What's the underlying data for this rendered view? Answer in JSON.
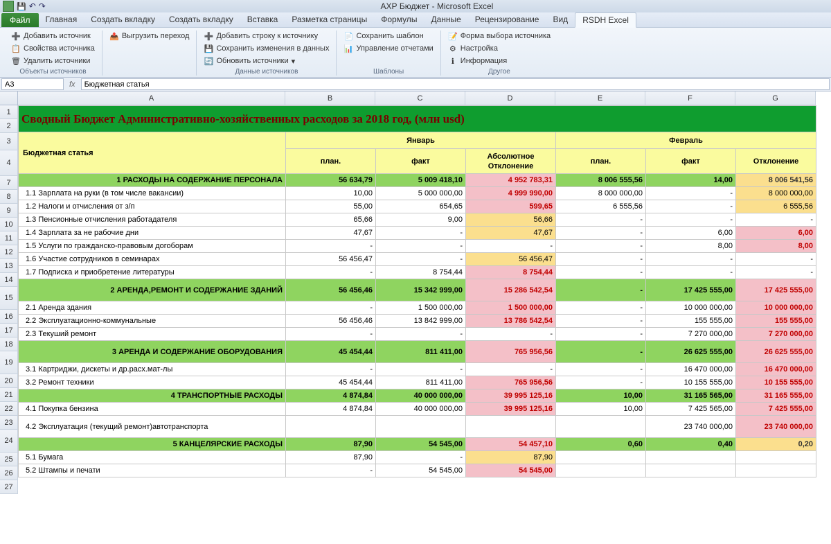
{
  "app": {
    "title": "АХР Бюджет  -  Microsoft Excel"
  },
  "tabs": {
    "file": "Файл",
    "items": [
      "Главная",
      "Создать вкладку",
      "Создать вкладку",
      "Вставка",
      "Разметка страницы",
      "Формулы",
      "Данные",
      "Рецензирование",
      "Вид",
      "RSDH Excel"
    ]
  },
  "ribbon": {
    "g1": {
      "i1": "Добавить источник",
      "i2": "Свойства источника",
      "i3": "Удалить источники",
      "label": "Объекты источников"
    },
    "g2": {
      "i1": "Выгрузить переход",
      "label": ""
    },
    "g3": {
      "i1": "Добавить строку к источнику",
      "i2": "Сохранить изменения в данных",
      "i3": "Обновить источники",
      "label": "Данные источников"
    },
    "g4": {
      "i1": "Сохранить шаблон",
      "i2": "Управление отчетами",
      "label": "Шаблоны"
    },
    "g5": {
      "i1": "Форма выбора источника",
      "i2": "Настройка",
      "i3": "Информация",
      "label": "Другое"
    }
  },
  "namebox": {
    "ref": "A3",
    "fx": "fx",
    "formula": "Бюджетная статья"
  },
  "cols": [
    "A",
    "B",
    "C",
    "D",
    "E",
    "F",
    "G"
  ],
  "rownums": [
    "1",
    "2",
    "3",
    "4",
    "7",
    "8",
    "9",
    "10",
    "11",
    "12",
    "13",
    "14",
    "15",
    "16",
    "17",
    "18",
    "19",
    "20",
    "21",
    "22",
    "23",
    "24",
    "25",
    "26",
    "27"
  ],
  "sheet": {
    "title": "Сводный Бюджет Административно-хозяйственных расходов за 2018 год, (млн usd)",
    "colA_header": "Бюджетная статья",
    "month1": "Январь",
    "month2": "Февраль",
    "sub": {
      "plan": "план.",
      "fact": "факт",
      "devAbs": "Абсолютное Отклонение",
      "dev": "Отклонение"
    },
    "rows": [
      {
        "n": "7",
        "type": "cat",
        "a": "1 РАСХОДЫ НА СОДЕРЖАНИЕ ПЕРСОНАЛА",
        "b": "56 634,79",
        "c": "5 009 418,10",
        "d": "4 952 783,31",
        "e": "8 006 555,56",
        "f": "14,00",
        "g": "8 006 541,56",
        "gcls": "orange"
      },
      {
        "n": "8",
        "a": "1.1 Зарплата на руки (в том числе вакансии)",
        "b": "10,00",
        "c": "5 000 000,00",
        "d": "4 999 990,00",
        "dcls": "pink",
        "e": "8 000 000,00",
        "f": "-",
        "g": "8 000 000,00",
        "gcls": "orange"
      },
      {
        "n": "9",
        "a": "1.2 Налоги и отчисления от з/п",
        "b": "55,00",
        "c": "654,65",
        "d": "599,65",
        "dcls": "pink",
        "e": "6 555,56",
        "f": "-",
        "g": "6 555,56",
        "gcls": "orange"
      },
      {
        "n": "10",
        "a": "1.3 Пенсионные отчисления работадателя",
        "b": "65,66",
        "c": "9,00",
        "d": "56,66",
        "dcls": "orange",
        "e": "-",
        "f": "-",
        "g": "-"
      },
      {
        "n": "11",
        "a": "1.4 Зарплата за не рабочие дни",
        "b": "47,67",
        "c": "-",
        "d": "47,67",
        "dcls": "orange",
        "e": "-",
        "f": "6,00",
        "g": "6,00",
        "gcls": "pink"
      },
      {
        "n": "12",
        "a": "1.5 Услуги по гражданско-правовым догоборам",
        "b": "-",
        "c": "-",
        "d": "-",
        "e": "-",
        "f": "8,00",
        "g": "8,00",
        "gcls": "pink"
      },
      {
        "n": "13",
        "a": "1.6 Участие сотрудников в семинарах",
        "b": "56 456,47",
        "c": "-",
        "d": "56 456,47",
        "dcls": "orange",
        "e": "-",
        "f": "-",
        "g": "-"
      },
      {
        "n": "14",
        "a": "1.7 Подписка и приобретение литературы",
        "b": "-",
        "c": "8 754,44",
        "d": "8 754,44",
        "dcls": "pink",
        "e": "-",
        "f": "-",
        "g": "-"
      },
      {
        "n": "15",
        "type": "cat",
        "tall": true,
        "a": "2 АРЕНДА,РЕМОНТ И СОДЕРЖАНИЕ ЗДАНИЙ",
        "b": "56 456,46",
        "c": "15 342 999,00",
        "d": "15 286 542,54",
        "e": "-",
        "f": "17 425 555,00",
        "g": "17 425 555,00",
        "gcls": "pink"
      },
      {
        "n": "16",
        "a": "2.1 Аренда здания",
        "b": "-",
        "c": "1 500 000,00",
        "d": "1 500 000,00",
        "dcls": "pink",
        "e": "-",
        "f": "10 000 000,00",
        "g": "10 000 000,00",
        "gcls": "pink"
      },
      {
        "n": "17",
        "a": "2.2 Эксплуатационно-коммунальные",
        "b": "56 456,46",
        "c": "13 842 999,00",
        "d": "13 786 542,54",
        "dcls": "pink",
        "e": "-",
        "f": "155 555,00",
        "g": "155 555,00",
        "gcls": "pink"
      },
      {
        "n": "18",
        "a": "2.3 Текуший ремонт",
        "b": "-",
        "c": "-",
        "d": "-",
        "e": "-",
        "f": "7 270 000,00",
        "g": "7 270 000,00",
        "gcls": "pink"
      },
      {
        "n": "19",
        "type": "cat",
        "tall": true,
        "a": "3 АРЕНДА И СОДЕРЖАНИЕ ОБОРУДОВАНИЯ",
        "b": "45 454,44",
        "c": "811 411,00",
        "d": "765 956,56",
        "e": "-",
        "f": "26 625 555,00",
        "g": "26 625 555,00",
        "gcls": "pink"
      },
      {
        "n": "20",
        "a": "3.1 Картриджи, дискеты и др.расх.мат-лы",
        "b": "-",
        "c": "-",
        "d": "-",
        "e": "-",
        "f": "16 470 000,00",
        "g": "16 470 000,00",
        "gcls": "pink"
      },
      {
        "n": "21",
        "a": "3.2 Ремонт техники",
        "b": "45 454,44",
        "c": "811 411,00",
        "d": "765 956,56",
        "dcls": "pink",
        "e": "-",
        "f": "10 155 555,00",
        "g": "10 155 555,00",
        "gcls": "pink"
      },
      {
        "n": "22",
        "type": "cat",
        "a": "4 ТРАНСПОРТНЫЕ РАСХОДЫ",
        "b": "4 874,84",
        "c": "40 000 000,00",
        "d": "39 995 125,16",
        "e": "10,00",
        "f": "31 165 565,00",
        "g": "31 165 555,00",
        "gcls": "pink"
      },
      {
        "n": "23",
        "a": "4.1 Покупка бензина",
        "b": "4 874,84",
        "c": "40 000 000,00",
        "d": "39 995 125,16",
        "dcls": "pink",
        "e": "10,00",
        "f": "7 425 565,00",
        "g": "7 425 555,00",
        "gcls": "pink"
      },
      {
        "n": "24",
        "tall": true,
        "a": "4.2 Эксплуатация (текущий ремонт)автотранспорта",
        "b": "",
        "c": "",
        "d": "",
        "e": "",
        "f": "23 740 000,00",
        "g": "23 740 000,00",
        "gcls": "pink"
      },
      {
        "n": "25",
        "type": "cat",
        "a": "5 КАНЦЕЛЯРСКИЕ РАСХОДЫ",
        "b": "87,90",
        "c": "54 545,00",
        "d": "54 457,10",
        "e": "0,60",
        "f": "0,40",
        "g": "0,20",
        "gcls": "orange"
      },
      {
        "n": "26",
        "a": "5.1 Бумага",
        "b": "87,90",
        "c": "-",
        "d": "87,90",
        "dcls": "orange",
        "e": "",
        "f": "",
        "g": ""
      },
      {
        "n": "27",
        "a": "5.2 Штампы и печати",
        "b": "-",
        "c": "54 545,00",
        "d": "54 545,00",
        "dcls": "pink",
        "e": "",
        "f": "",
        "g": ""
      }
    ]
  }
}
